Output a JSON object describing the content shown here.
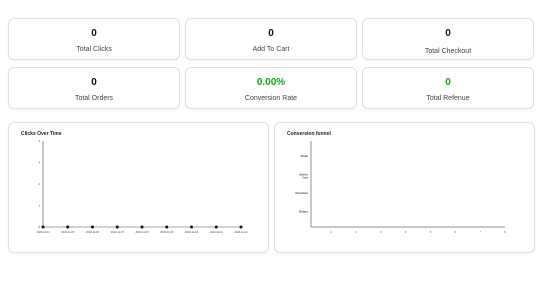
{
  "stats": [
    {
      "value": "0",
      "label": "Total Clicks",
      "color": "#111111"
    },
    {
      "value": "0",
      "label": "Add To Cart",
      "color": "#111111"
    },
    {
      "value": "0",
      "label": "Total Checkout",
      "color": "#111111"
    },
    {
      "value": "0",
      "label": "Total Orders",
      "color": "#111111"
    },
    {
      "value": "0.00%",
      "label": "Conversion Rate",
      "color": "#13a313"
    },
    {
      "value": "0",
      "label": "Total Refenue",
      "color": "#13a313"
    }
  ],
  "clicks_chart": {
    "title": "Clicks Over Time"
  },
  "funnel_chart": {
    "title": "Conversion funnel"
  },
  "chart_data": [
    {
      "type": "line",
      "title": "Clicks Over Time",
      "x": [
        "2023-11-04",
        "2023-11-05",
        "2023-11-06",
        "2023-11-07",
        "2023-11-08",
        "2023-11-09",
        "2023-11-10",
        "2023-11-11",
        "2023-11-12"
      ],
      "series": [
        {
          "values": [
            0,
            0,
            0,
            0,
            0,
            0,
            0,
            0,
            0
          ]
        }
      ],
      "yticks": [
        "0",
        "1",
        "2",
        "3",
        "4"
      ],
      "ylim": [
        0,
        4
      ],
      "grid": false
    },
    {
      "type": "bar",
      "title": "Conversion funnel",
      "categories": [
        "Visits",
        "Add to Cart",
        "Checkout",
        "Orders"
      ],
      "values": [
        0,
        0,
        0,
        0
      ],
      "xticks": [
        "1",
        "2",
        "3",
        "4",
        "5",
        "6",
        "7",
        "8"
      ],
      "orientation": "horizontal",
      "grid": false
    }
  ]
}
